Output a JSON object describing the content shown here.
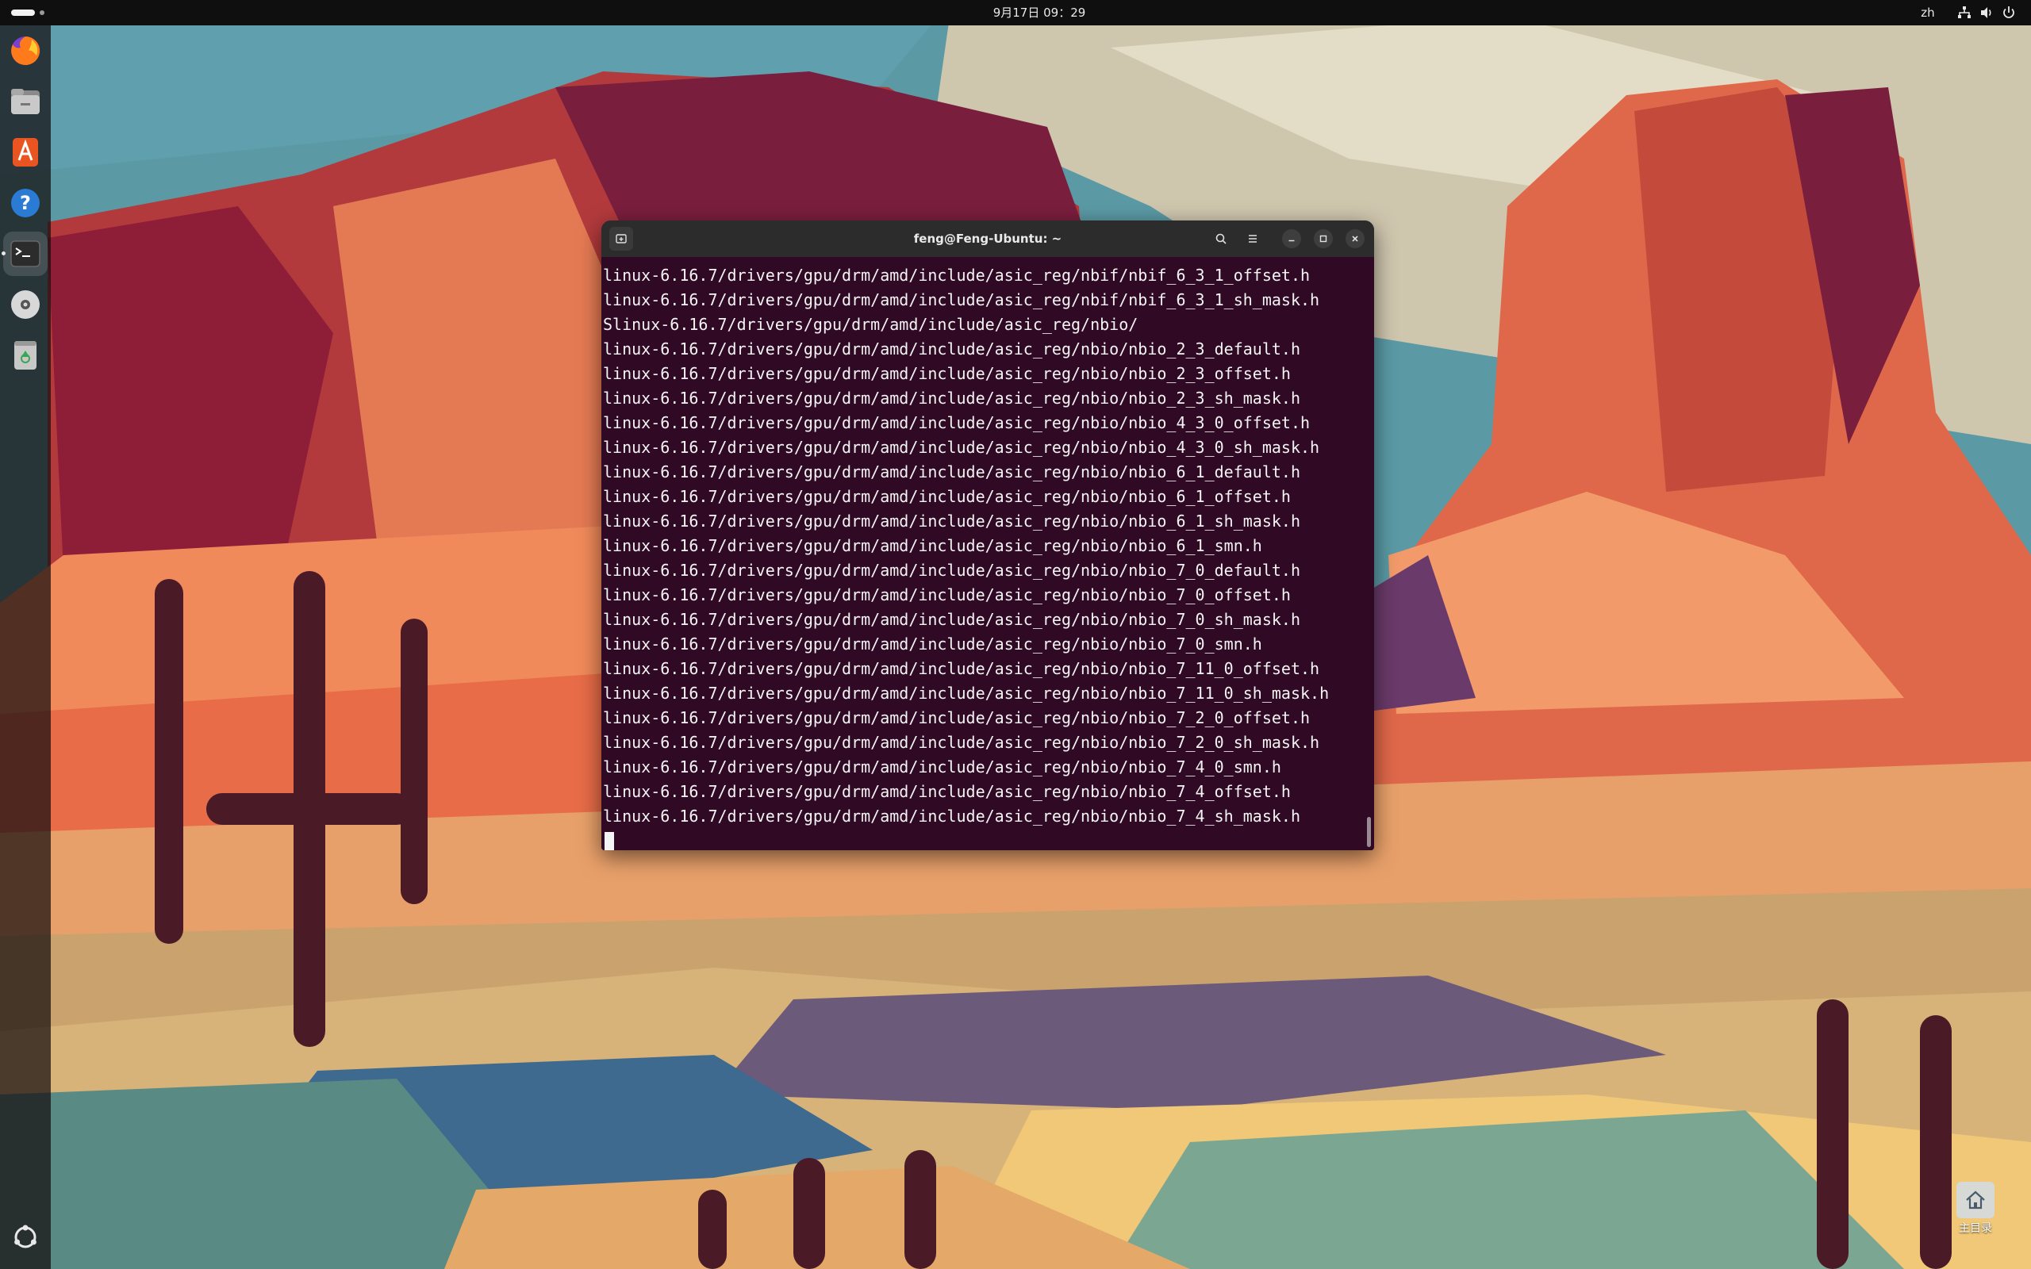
{
  "topbar": {
    "clock": "9月17日 09：29",
    "lang": "zh"
  },
  "dock": {
    "items": [
      "firefox-icon",
      "files-icon",
      "app-center-icon",
      "help-icon",
      "terminal-icon",
      "disc-icon",
      "trash-icon",
      "show-apps-icon"
    ]
  },
  "terminal": {
    "title": "feng@Feng-Ubuntu: ~",
    "lines": [
      "linux-6.16.7/drivers/gpu/drm/amd/include/asic_reg/nbif/nbif_6_3_1_offset.h",
      "linux-6.16.7/drivers/gpu/drm/amd/include/asic_reg/nbif/nbif_6_3_1_sh_mask.h",
      "Slinux-6.16.7/drivers/gpu/drm/amd/include/asic_reg/nbio/",
      "linux-6.16.7/drivers/gpu/drm/amd/include/asic_reg/nbio/nbio_2_3_default.h",
      "linux-6.16.7/drivers/gpu/drm/amd/include/asic_reg/nbio/nbio_2_3_offset.h",
      "linux-6.16.7/drivers/gpu/drm/amd/include/asic_reg/nbio/nbio_2_3_sh_mask.h",
      "linux-6.16.7/drivers/gpu/drm/amd/include/asic_reg/nbio/nbio_4_3_0_offset.h",
      "linux-6.16.7/drivers/gpu/drm/amd/include/asic_reg/nbio/nbio_4_3_0_sh_mask.h",
      "linux-6.16.7/drivers/gpu/drm/amd/include/asic_reg/nbio/nbio_6_1_default.h",
      "linux-6.16.7/drivers/gpu/drm/amd/include/asic_reg/nbio/nbio_6_1_offset.h",
      "linux-6.16.7/drivers/gpu/drm/amd/include/asic_reg/nbio/nbio_6_1_sh_mask.h",
      "linux-6.16.7/drivers/gpu/drm/amd/include/asic_reg/nbio/nbio_6_1_smn.h",
      "linux-6.16.7/drivers/gpu/drm/amd/include/asic_reg/nbio/nbio_7_0_default.h",
      "linux-6.16.7/drivers/gpu/drm/amd/include/asic_reg/nbio/nbio_7_0_offset.h",
      "linux-6.16.7/drivers/gpu/drm/amd/include/asic_reg/nbio/nbio_7_0_sh_mask.h",
      "linux-6.16.7/drivers/gpu/drm/amd/include/asic_reg/nbio/nbio_7_0_smn.h",
      "linux-6.16.7/drivers/gpu/drm/amd/include/asic_reg/nbio/nbio_7_11_0_offset.h",
      "linux-6.16.7/drivers/gpu/drm/amd/include/asic_reg/nbio/nbio_7_11_0_sh_mask.h",
      "linux-6.16.7/drivers/gpu/drm/amd/include/asic_reg/nbio/nbio_7_2_0_offset.h",
      "linux-6.16.7/drivers/gpu/drm/amd/include/asic_reg/nbio/nbio_7_2_0_sh_mask.h",
      "linux-6.16.7/drivers/gpu/drm/amd/include/asic_reg/nbio/nbio_7_4_0_smn.h",
      "linux-6.16.7/drivers/gpu/drm/amd/include/asic_reg/nbio/nbio_7_4_offset.h",
      "linux-6.16.7/drivers/gpu/drm/amd/include/asic_reg/nbio/nbio_7_4_sh_mask.h"
    ]
  },
  "desktop": {
    "home_label": "主目录"
  },
  "colors": {
    "terminal_bg": "#300a24",
    "titlebar_bg": "#2c2c2c",
    "topbar_bg": "#0f0f0f"
  }
}
